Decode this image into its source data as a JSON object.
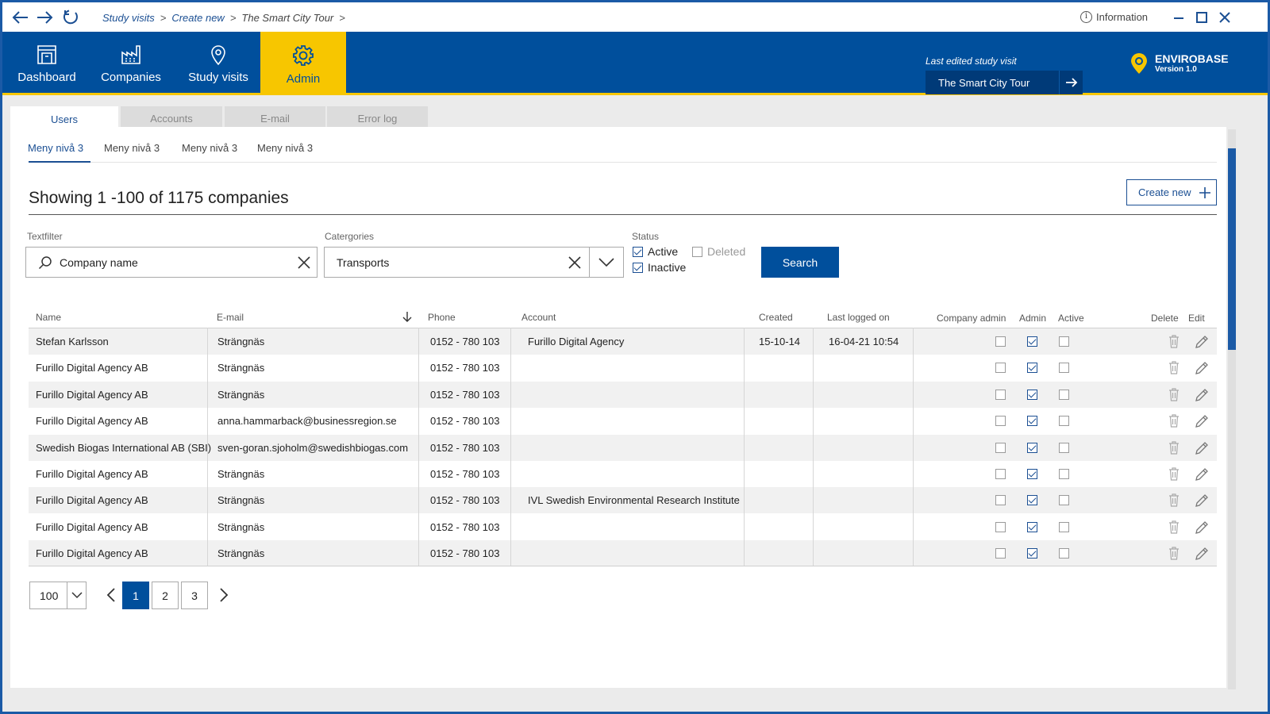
{
  "window": {
    "breadcrumbs": [
      "Study visits",
      "Create new",
      "The Smart City Tour"
    ],
    "breadcrumb_separator": ">",
    "information_label": "Information"
  },
  "header": {
    "tabs": [
      {
        "label": "Dashboard",
        "icon": "dashboard-icon"
      },
      {
        "label": "Companies",
        "icon": "factory-icon"
      },
      {
        "label": "Study visits",
        "icon": "map-pin-icon"
      },
      {
        "label": "Admin",
        "icon": "gear-icon",
        "active": true
      }
    ],
    "last_edited_label": "Last edited study visit",
    "last_edited_value": "The Smart City Tour",
    "brand_name": "ENVIROBASE",
    "brand_version": "Version 1.0",
    "colors": {
      "primary": "#004f9c",
      "accent": "#f7c600"
    }
  },
  "section_tabs": [
    "Users",
    "Accounts",
    "E-mail",
    "Error log"
  ],
  "sub_tabs": [
    "Meny nivå 3",
    "Meny nivå 3",
    "Meny nivå 3",
    "Meny nivå 3"
  ],
  "listing": {
    "title": "Showing 1 -100 of 1175 companies",
    "create_label": "Create new"
  },
  "filters": {
    "textfilter_label": "Textfilter",
    "textfilter_placeholder": "Company name",
    "categories_label": "Catergories",
    "categories_value": "Transports",
    "status_label": "Status",
    "status_active": "Active",
    "status_inactive": "Inactive",
    "status_deleted": "Deleted",
    "search_label": "Search"
  },
  "table": {
    "headers": {
      "name": "Name",
      "email": "E-mail",
      "phone": "Phone",
      "account": "Account",
      "created": "Created",
      "last_logged": "Last logged on",
      "company_admin": "Company admin",
      "admin": "Admin",
      "active": "Active",
      "delete": "Delete",
      "edit": "Edit"
    },
    "rows": [
      {
        "name": "Stefan Karlsson",
        "email": "Strängnäs",
        "phone": "0152 - 780 103",
        "account": "Furillo Digital Agency",
        "created": "15-10-14",
        "last": "16-04-21 10:54",
        "company_admin": false,
        "admin": true,
        "active": false
      },
      {
        "name": "Furillo Digital Agency AB",
        "email": "Strängnäs",
        "phone": "0152 - 780 103",
        "account": "",
        "created": "",
        "last": "",
        "company_admin": false,
        "admin": true,
        "active": false
      },
      {
        "name": "Furillo Digital Agency AB",
        "email": "Strängnäs",
        "phone": "0152 - 780 103",
        "account": "",
        "created": "",
        "last": "",
        "company_admin": false,
        "admin": true,
        "active": false
      },
      {
        "name": "Furillo Digital Agency AB",
        "email": "anna.hammarback@businessregion.se",
        "phone": "0152 - 780 103",
        "account": "",
        "created": "",
        "last": "",
        "company_admin": false,
        "admin": true,
        "active": false
      },
      {
        "name": "Swedish Biogas International AB (SBI)",
        "email": "sven-goran.sjoholm@swedishbiogas.com",
        "phone": "0152 - 780 103",
        "account": "",
        "created": "",
        "last": "",
        "company_admin": false,
        "admin": true,
        "active": false
      },
      {
        "name": "Furillo Digital Agency AB",
        "email": "Strängnäs",
        "phone": "0152 - 780 103",
        "account": "",
        "created": "",
        "last": "",
        "company_admin": false,
        "admin": true,
        "active": false
      },
      {
        "name": "Furillo Digital Agency AB",
        "email": "Strängnäs",
        "phone": "0152 - 780 103",
        "account": "IVL Swedish Environmental Research Institute",
        "created": "",
        "last": "",
        "company_admin": false,
        "admin": true,
        "active": false
      },
      {
        "name": "Furillo Digital Agency AB",
        "email": "Strängnäs",
        "phone": "0152 - 780 103",
        "account": "",
        "created": "",
        "last": "",
        "company_admin": false,
        "admin": true,
        "active": false
      },
      {
        "name": "Furillo Digital Agency AB",
        "email": "Strängnäs",
        "phone": "0152 - 780 103",
        "account": "",
        "created": "",
        "last": "",
        "company_admin": false,
        "admin": true,
        "active": false
      }
    ]
  },
  "pagination": {
    "per_page": "100",
    "pages": [
      "1",
      "2",
      "3"
    ],
    "current_page": "1"
  }
}
